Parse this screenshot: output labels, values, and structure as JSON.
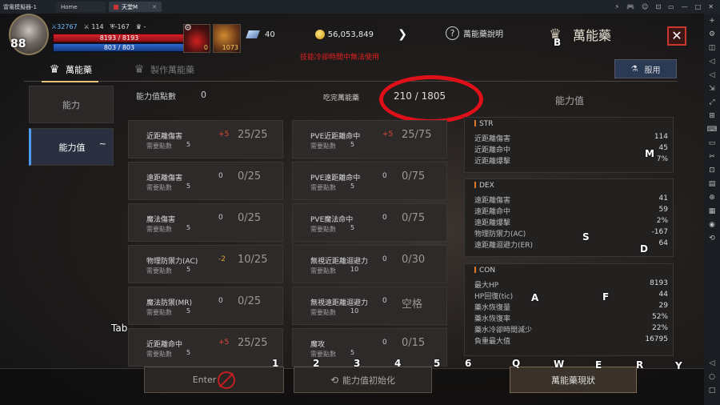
{
  "emulator": {
    "app_name": "雷電模擬器-1",
    "tabs": [
      {
        "label": "Home"
      },
      {
        "label": "天堂M"
      }
    ],
    "window_controls": [
      "⚡",
      "🎮",
      "☺",
      "⊡",
      "▭",
      "—",
      "□",
      "✕"
    ],
    "sidebar_tools": [
      "+",
      "⚙",
      "◫",
      "◁",
      "◁",
      "⇲",
      "⤢",
      "⊞",
      "⌨",
      "▭",
      "✂",
      "⊡",
      "▤",
      "⊕",
      "▦",
      "◉",
      "⟲"
    ],
    "sidebar_nav": [
      "◁",
      "○",
      "□"
    ]
  },
  "hud": {
    "level": "88",
    "power": "32767",
    "swords": "114",
    "shield": "-167",
    "trophy": "-",
    "hp": "8193 / 8193",
    "mp": "803 / 803",
    "buff1_count": "0",
    "buff2_count": "1073",
    "gem_count": "40",
    "gold": "56,053,849"
  },
  "header": {
    "help_label": "萬能藥說明",
    "title": "萬能藥",
    "close": "✕",
    "red_message": "技能冷卻時間中無法使用"
  },
  "tabs": {
    "active": "萬能藥",
    "craft": "製作萬能藥",
    "use_button": "服用"
  },
  "sidenav": {
    "ability": "能力",
    "stats": "能力值",
    "stats_icon": "~"
  },
  "summary": {
    "points_label": "能力值點數",
    "points_value": "0",
    "used_label": "吃完萬能藥",
    "used_value": "210 / 1805"
  },
  "cards_left": [
    {
      "name": "近距離傷害",
      "sub_label": "需要點數",
      "sub_value": "5",
      "bonus": "+5",
      "progress": "25/25"
    },
    {
      "name": "遠距離傷害",
      "sub_label": "需要點數",
      "sub_value": "5",
      "bonus": "0",
      "progress": "0/25"
    },
    {
      "name": "魔法傷害",
      "sub_label": "需要點數",
      "sub_value": "5",
      "bonus": "0",
      "progress": "0/25"
    },
    {
      "name": "物理防禦力(AC)",
      "sub_label": "需要點數",
      "sub_value": "5",
      "bonus": "-2",
      "progress": "10/25"
    },
    {
      "name": "魔法防禦(MR)",
      "sub_label": "需要點數",
      "sub_value": "5",
      "bonus": "0",
      "progress": "0/25"
    },
    {
      "name": "近距離命中",
      "sub_label": "需要點數",
      "sub_value": "5",
      "bonus": "+5",
      "progress": "25/25"
    }
  ],
  "cards_right": [
    {
      "name": "PVE近距離命中",
      "sub_label": "需要點數",
      "sub_value": "5",
      "bonus": "+5",
      "progress": "25/75"
    },
    {
      "name": "PVE遠距離命中",
      "sub_label": "需要點數",
      "sub_value": "5",
      "bonus": "0",
      "progress": "0/75"
    },
    {
      "name": "PVE魔法命中",
      "sub_label": "需要點數",
      "sub_value": "5",
      "bonus": "0",
      "progress": "0/75"
    },
    {
      "name": "無視近距離迴避力",
      "sub_label": "需要點數",
      "sub_value": "10",
      "bonus": "0",
      "progress": "0/30"
    },
    {
      "name": "無視遠距離迴避力",
      "sub_label": "需要點數",
      "sub_value": "10",
      "bonus": "0",
      "progress": "空格"
    },
    {
      "name": "魔攻",
      "sub_label": "需要點數",
      "sub_value": "5",
      "bonus": "0",
      "progress": "0/15"
    }
  ],
  "stats_panel": {
    "title": "能力值",
    "str": {
      "name": "STR",
      "rows": [
        {
          "k": "近距離傷害",
          "v": "114"
        },
        {
          "k": "近距離命中",
          "v": "45"
        },
        {
          "k": "近距離爆擊",
          "v": "7%"
        }
      ]
    },
    "dex": {
      "name": "DEX",
      "rows": [
        {
          "k": "遠距離傷害",
          "v": "41"
        },
        {
          "k": "遠距離命中",
          "v": "59"
        },
        {
          "k": "遠距離爆擊",
          "v": "2%"
        },
        {
          "k": "物理防禦力(AC)",
          "v": "-167"
        },
        {
          "k": "遠距離迴避力(ER)",
          "v": "64"
        }
      ]
    },
    "con": {
      "name": "CON",
      "rows": [
        {
          "k": "最大HP",
          "v": "8193"
        },
        {
          "k": "HP回復(tic)",
          "v": "44"
        },
        {
          "k": "藥水恢復量",
          "v": "29"
        },
        {
          "k": "藥水恢復率",
          "v": "52%"
        },
        {
          "k": "藥水冷卻時間減少",
          "v": "22%"
        },
        {
          "k": "負重最大值",
          "v": "16795"
        }
      ]
    }
  },
  "keys": {
    "M": "M",
    "S": "S",
    "D": "D",
    "A": "A",
    "F": "F",
    "B": "B",
    "tab": "Tab",
    "n1": "1",
    "n2": "2",
    "n3": "3",
    "n4": "4",
    "n5": "5",
    "n6": "6",
    "Q": "Q",
    "W": "W",
    "E": "E",
    "R": "R",
    "Y": "Y"
  },
  "bottom": {
    "enter": "Enter",
    "reset": "能力值初始化",
    "status": "萬能藥現狀"
  }
}
